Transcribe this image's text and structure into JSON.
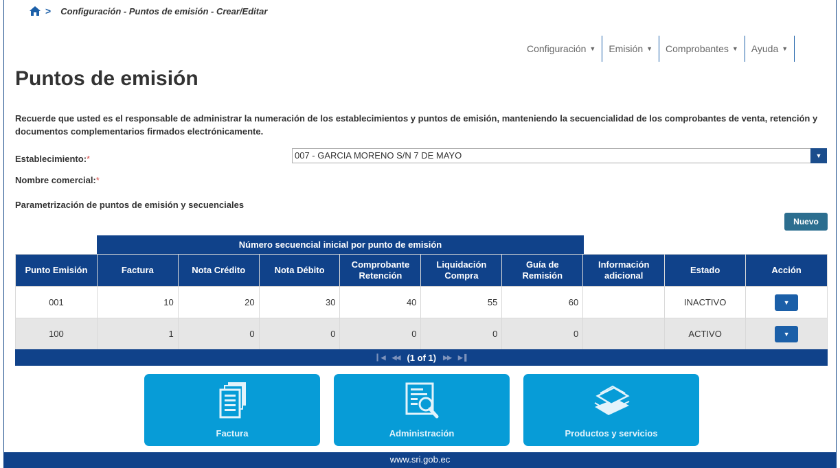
{
  "breadcrumb": {
    "text": "Configuración - Puntos de emisión - Crear/Editar"
  },
  "nav": {
    "items": [
      {
        "label": "Configuración"
      },
      {
        "label": "Emisión"
      },
      {
        "label": "Comprobantes"
      },
      {
        "label": "Ayuda"
      }
    ]
  },
  "page": {
    "title": "Puntos de emisión",
    "notice": "Recuerde que usted es el responsable de administrar la numeración de los establecimientos y puntos de emisión, manteniendo la secuencialidad de los comprobantes de venta, retención y documentos complementarios firmados electrónicamente."
  },
  "form": {
    "establecimiento_label": "Establecimiento:",
    "establecimiento_value": "007 - GARCIA MORENO S/N 7 DE MAYO",
    "nombre_label": "Nombre comercial:",
    "required_mark": "*",
    "section_title": "Parametrización de puntos de emisión y secuenciales",
    "nuevo_label": "Nuevo"
  },
  "table": {
    "group_header": "Número secuencial inicial por punto de emisión",
    "headers": {
      "punto": "Punto Emisión",
      "factura": "Factura",
      "nota_credito": "Nota Crédito",
      "nota_debito": "Nota Débito",
      "comprobante_1": "Comprobante",
      "comprobante_2": "Retención",
      "liquidacion_1": "Liquidación",
      "liquidacion_2": "Compra",
      "guia_1": "Guía de",
      "guia_2": "Remisión",
      "info_1": "Información",
      "info_2": "adicional",
      "estado": "Estado",
      "accion": "Acción"
    },
    "rows": [
      {
        "punto": "001",
        "factura": "10",
        "nota_credito": "20",
        "nota_debito": "30",
        "retencion": "40",
        "liquidacion": "55",
        "guia": "60",
        "info": "",
        "estado": "INACTIVO"
      },
      {
        "punto": "100",
        "factura": "1",
        "nota_credito": "0",
        "nota_debito": "0",
        "retencion": "0",
        "liquidacion": "0",
        "guia": "0",
        "info": "",
        "estado": "ACTIVO"
      }
    ],
    "pager": {
      "text": "(1 of 1)"
    }
  },
  "tiles": [
    {
      "label": "Factura",
      "icon": "documents-icon"
    },
    {
      "label": "Administración",
      "icon": "document-search-icon"
    },
    {
      "label": "Productos y servicios",
      "icon": "paper-stack-icon"
    }
  ],
  "footer": {
    "text": "www.sri.gob.ec"
  },
  "colors": {
    "primary": "#10428a",
    "tile": "#079cd7",
    "required": "#d9534f",
    "button": "#2c6e8f"
  }
}
